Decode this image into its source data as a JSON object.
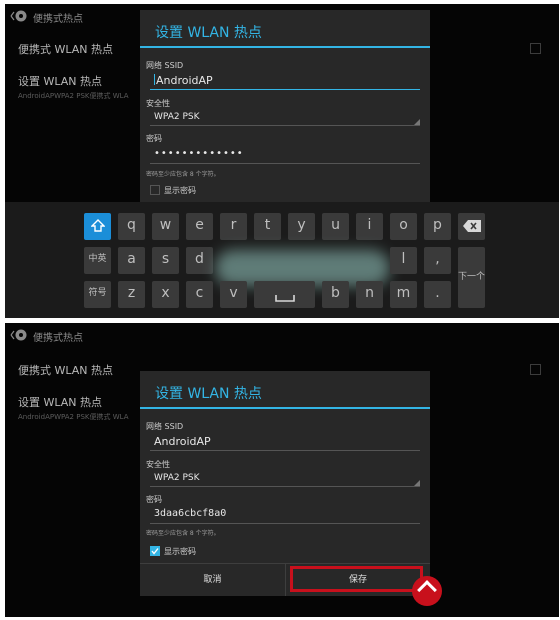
{
  "colors": {
    "accent": "#33b5e5",
    "highlight": "#c8101c",
    "shift_key": "#1b8ed8"
  },
  "top": {
    "app_title": "便携式热点",
    "settings": [
      {
        "title": "便携式 WLAN 热点",
        "subtitle": ""
      },
      {
        "title": "设置 WLAN 热点",
        "subtitle": "AndroidAPWPA2 PSK便携式 WLA"
      }
    ],
    "dialog": {
      "title": "设置 WLAN 热点",
      "ssid_label": "网络 SSID",
      "ssid_value": "AndroidAP",
      "security_label": "安全性",
      "security_value": "WPA2 PSK",
      "password_label": "密码",
      "password_value": "•••••••••••••",
      "hint": "密码至少应包含 8 个字符。",
      "show_password": "显示密码",
      "show_password_checked": false
    },
    "keyboard": {
      "row1": [
        "q",
        "w",
        "e",
        "r",
        "t",
        "y",
        "u",
        "i",
        "o",
        "p"
      ],
      "row2": [
        "中英",
        "a",
        "s",
        "d",
        "l",
        ","
      ],
      "row3": [
        "符号",
        "z",
        "x",
        "c",
        "v",
        "b",
        "n",
        "m",
        "."
      ],
      "next": "下一个",
      "shift_icon": "shift-up-arrow-icon",
      "backspace_icon": "backspace-icon",
      "space_icon": "space-bar-icon"
    }
  },
  "bottom": {
    "app_title": "便携式热点",
    "settings": [
      {
        "title": "便携式 WLAN 热点",
        "subtitle": ""
      },
      {
        "title": "设置 WLAN 热点",
        "subtitle": "AndroidAPWPA2 PSK便携式 WLA"
      }
    ],
    "dialog": {
      "title": "设置 WLAN 热点",
      "ssid_label": "网络 SSID",
      "ssid_value": "AndroidAP",
      "security_label": "安全性",
      "security_value": "WPA2 PSK",
      "password_label": "密码",
      "password_value": "3daa6cbcf8a0",
      "hint": "密码至少应包含 8 个字符。",
      "show_password": "显示密码",
      "show_password_checked": true,
      "cancel_label": "取消",
      "save_label": "保存"
    }
  }
}
